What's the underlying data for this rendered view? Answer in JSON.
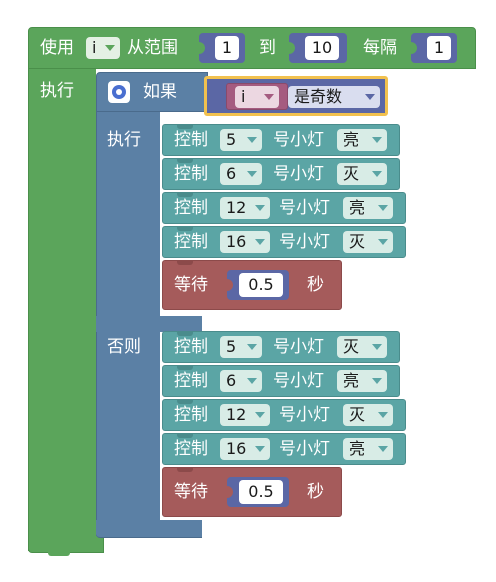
{
  "loop": {
    "use_label": "使用",
    "variable": "i",
    "from_label": "从范围",
    "start": "1",
    "to_label": "到",
    "end": "10",
    "step_label": "每隔",
    "step": "1",
    "do_label": "执行"
  },
  "if_block": {
    "if_label": "如果",
    "condition_var": "i",
    "condition_test": "是奇数",
    "then_label": "执行",
    "else_label": "否则"
  },
  "then_branch": [
    {
      "action": "控制",
      "pin": "5",
      "unit": "号小灯",
      "state": "亮"
    },
    {
      "action": "控制",
      "pin": "6",
      "unit": "号小灯",
      "state": "灭"
    },
    {
      "action": "控制",
      "pin": "12",
      "unit": "号小灯",
      "state": "亮"
    },
    {
      "action": "控制",
      "pin": "16",
      "unit": "号小灯",
      "state": "灭"
    }
  ],
  "then_wait": {
    "label": "等待",
    "value": "0.5",
    "unit": "秒"
  },
  "else_branch": [
    {
      "action": "控制",
      "pin": "5",
      "unit": "号小灯",
      "state": "灭"
    },
    {
      "action": "控制",
      "pin": "6",
      "unit": "号小灯",
      "state": "亮"
    },
    {
      "action": "控制",
      "pin": "12",
      "unit": "号小灯",
      "state": "灭"
    },
    {
      "action": "控制",
      "pin": "16",
      "unit": "号小灯",
      "state": "亮"
    }
  ],
  "else_wait": {
    "label": "等待",
    "value": "0.5",
    "unit": "秒"
  },
  "colors": {
    "loop": "#5ba55b",
    "logic": "#5b80a5",
    "control_light": "#5ba5a5",
    "wait": "#a55b5b",
    "variable": "#a55b80",
    "condition": "#5b67a5",
    "selected_outline": "#f2c14e"
  }
}
